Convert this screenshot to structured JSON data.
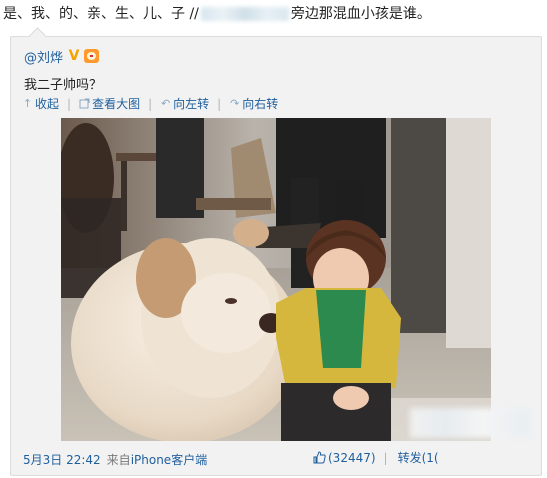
{
  "top": {
    "text_before": "是、我、的、亲、生、儿、子 //",
    "text_after": "旁边那混血小孩是谁。"
  },
  "post": {
    "author": "@刘烨",
    "vip_badge": "V",
    "content": "我二子帅吗？",
    "toolbar": {
      "collapse": "收起",
      "view_large": "查看大图",
      "rotate_left": "向左转",
      "rotate_right": "向右转"
    },
    "timestamp": "5月3日 22:42",
    "source_prefix": "来自",
    "source": "iPhone客户端",
    "likes": "(32447)",
    "repost": "转发(1("
  },
  "colors": {
    "link": "#1f5f9e",
    "card_bg": "#f2f2f2",
    "vip": "#f5a300"
  },
  "icons": [
    "collapse-arrow-icon",
    "view-large-icon",
    "rotate-left-icon",
    "rotate-right-icon",
    "thumbs-up-icon",
    "vip-badge-icon",
    "club-badge-icon"
  ]
}
